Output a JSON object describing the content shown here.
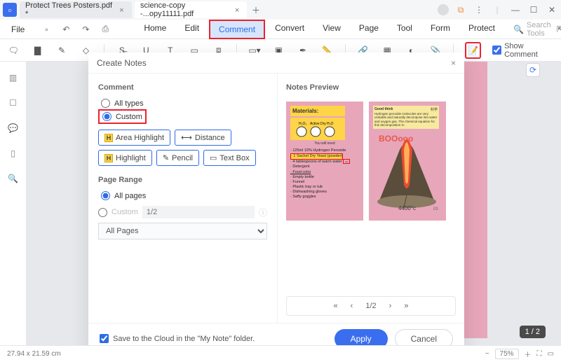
{
  "titlebar": {
    "tabs": [
      {
        "label": "Protect Trees Posters.pdf *"
      },
      {
        "label": "science-copy -...opy11111.pdf"
      }
    ]
  },
  "menubar": {
    "file": "File",
    "tabs": [
      "Home",
      "Edit",
      "Comment",
      "Convert",
      "View",
      "Page",
      "Tool",
      "Form",
      "Protect"
    ],
    "search_placeholder": "Search Tools"
  },
  "toolbar": {
    "show_comment": "Show Comment"
  },
  "workspace": {
    "page_indicator": "1 / 2"
  },
  "dialog": {
    "title": "Create Notes",
    "comment_section": "Comment",
    "all_types": "All types",
    "custom": "Custom",
    "chips": {
      "area": "Area Highlight",
      "distance": "Distance",
      "highlight": "Highlight",
      "pencil": "Pencil",
      "textbox": "Text Box"
    },
    "page_range": "Page Range",
    "all_pages": "All pages",
    "custom_pages": "Custom",
    "custom_placeholder": "1/2",
    "dropdown": "All Pages",
    "preview_title": "Notes Preview",
    "preview": {
      "materials_title": "Materials:",
      "materials_items": [
        "125ml 10% Hydrogen Peroxide",
        "1 Sachet Dry Yeast (powder)",
        "4 tablespoons of warm water",
        "Detergent",
        "Food color",
        "Empty bottle",
        "Funnel",
        "Plastic tray or tub",
        "Dishwashing gloves",
        "Safty goggles"
      ],
      "volcano_title": "Good think",
      "volcano_temp": "4400°c",
      "volcano_boom": "BOOooo",
      "volcano_note": "Hydrogen peroxide molecules are very unstable and naturally decompose into water and oxygen gas. The chemical equation for this decomposition is:"
    },
    "pager": "1/2",
    "save_label": "Save to the Cloud in the \"My Note\" folder.",
    "apply": "Apply",
    "cancel": "Cancel"
  },
  "statusbar": {
    "dimensions": "27.94 x 21.59 cm",
    "zoom": "75%"
  }
}
